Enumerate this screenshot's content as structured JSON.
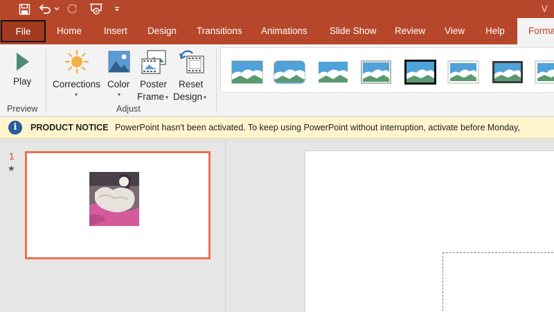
{
  "titlebar": {
    "title_fragment": "V"
  },
  "tabs": [
    {
      "id": "file",
      "label": "File"
    },
    {
      "id": "home",
      "label": "Home"
    },
    {
      "id": "insert",
      "label": "Insert"
    },
    {
      "id": "design",
      "label": "Design"
    },
    {
      "id": "transitions",
      "label": "Transitions"
    },
    {
      "id": "animations",
      "label": "Animations"
    },
    {
      "id": "slideshow",
      "label": "Slide Show"
    },
    {
      "id": "review",
      "label": "Review"
    },
    {
      "id": "view",
      "label": "View"
    },
    {
      "id": "help",
      "label": "Help"
    },
    {
      "id": "format",
      "label": "Forma"
    }
  ],
  "ribbon": {
    "preview": {
      "play_label": "Play",
      "group_label": "Preview"
    },
    "adjust": {
      "corrections_label": "Corrections",
      "color_label": "Color",
      "poster_frame_label_1": "Poster",
      "poster_frame_label_2": "Frame",
      "reset_design_label_1": "Reset",
      "reset_design_label_2": "Design",
      "group_label": "Adjust"
    },
    "video_styles_count": 8,
    "selected_style_index": 4
  },
  "notice": {
    "title": "PRODUCT NOTICE",
    "message": "PowerPoint hasn't been activated. To keep using PowerPoint without interruption, activate before Monday,"
  },
  "slides": {
    "number": "1",
    "star": "★"
  },
  "colors": {
    "accent": "#b7472a",
    "selection": "#e8734e",
    "notice_bg": "#fff4ce",
    "info_icon": "#2b5d9c"
  },
  "icons": {
    "save": "save-icon",
    "undo": "undo-icon",
    "redo": "redo-icon",
    "start_from_beginning": "slideshow-start-icon",
    "customize": "customize-qat-icon",
    "info": "info-icon"
  }
}
